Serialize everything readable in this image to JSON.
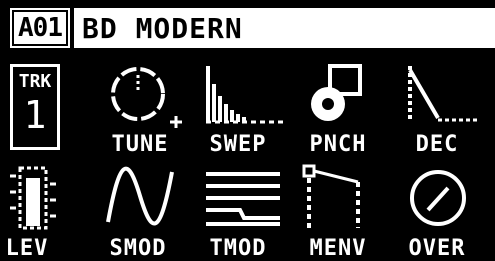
{
  "header": {
    "pattern": "A01",
    "kit_name": "BD MODERN"
  },
  "track": {
    "label": "TRK",
    "number": "1"
  },
  "params_row1": [
    {
      "label": "TUNE",
      "icon": "tune-dial-icon"
    },
    {
      "label": "SWEP",
      "icon": "sweep-bars-icon"
    },
    {
      "label": "PNCH",
      "icon": "punch-icon"
    },
    {
      "label": "DEC",
      "icon": "decay-envelope-icon"
    }
  ],
  "params_row2": [
    {
      "label": "LEV",
      "icon": "level-fader-icon"
    },
    {
      "label": "SMOD",
      "icon": "sine-wave-icon"
    },
    {
      "label": "TMOD",
      "icon": "transient-lines-icon"
    },
    {
      "label": "MENV",
      "icon": "mod-envelope-icon"
    },
    {
      "label": "OVER",
      "icon": "overdrive-dial-icon"
    }
  ],
  "colors": {
    "background": "#000000",
    "foreground": "#ffffff"
  }
}
